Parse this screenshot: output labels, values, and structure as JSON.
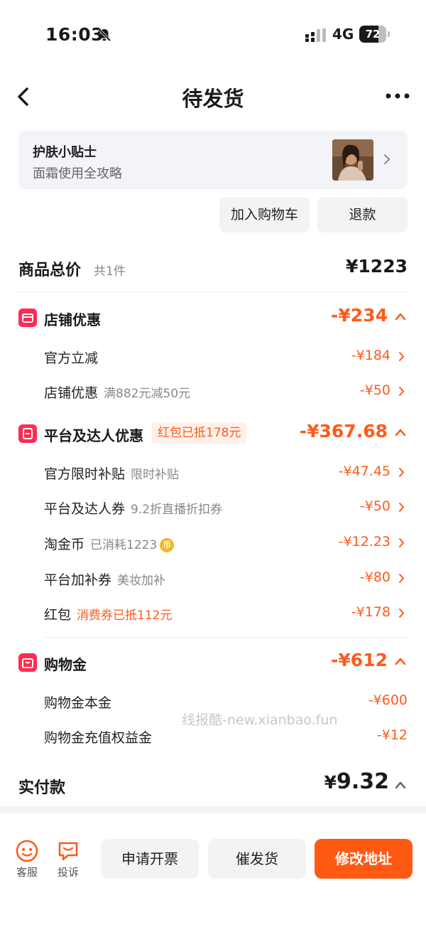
{
  "status_bar": {
    "time": "16:03",
    "network": "4G",
    "battery": "72",
    "battery_level": 0.72
  },
  "nav": {
    "title": "待发货"
  },
  "tip": {
    "title": "护肤小贴士",
    "subtitle": "面霜使用全攻略"
  },
  "actions": {
    "add_to_cart": "加入购物车",
    "refund": "退款"
  },
  "total": {
    "label": "商品总价",
    "count": "共1件",
    "amount": "¥1223"
  },
  "sections": [
    {
      "title": "店铺优惠",
      "badge": "",
      "amount": "-¥234",
      "items": [
        {
          "label": "官方立减",
          "sub": "",
          "amount": "-¥184"
        },
        {
          "label": "店铺优惠",
          "sub": "满882元减50元",
          "amount": "-¥50"
        }
      ]
    },
    {
      "title": "平台及达人优惠",
      "badge": "红包已抵178元",
      "amount": "-¥367.68",
      "items": [
        {
          "label": "官方限时补贴",
          "sub": "限时补贴",
          "amount": "-¥47.45"
        },
        {
          "label": "平台及达人券",
          "sub": "9.2折直播折扣券",
          "amount": "-¥50"
        },
        {
          "label": "淘金币",
          "sub": "已消耗1223",
          "amount": "-¥12.23"
        },
        {
          "label": "平台加补券",
          "sub": "美妆加补",
          "amount": "-¥80"
        },
        {
          "label": "红包",
          "sub": "消费券已抵112元",
          "amount": "-¥178"
        }
      ]
    },
    {
      "title": "购物金",
      "badge": "",
      "amount": "-¥612",
      "items": [
        {
          "label": "购物金本金",
          "sub": "",
          "amount": "-¥600"
        },
        {
          "label": "购物金充值权益金",
          "sub": "",
          "amount": "-¥12"
        }
      ]
    }
  ],
  "coin_glyph": "币",
  "watermark": "线报酷-new.xianbao.fun",
  "payment": {
    "label": "实付款",
    "currency": "¥",
    "amount": "9.32"
  },
  "bottom": {
    "service": "客服",
    "complaint": "投诉",
    "invoice": "申请开票",
    "urge": "催发货",
    "change_address": "修改地址"
  },
  "colors": {
    "accent": "#ff5a1a",
    "section_icon": "#ff2a52",
    "primary_button": "#ff5a14"
  },
  "icons": [
    "bell-slash-icon",
    "signal-icon",
    "back-icon",
    "more-icon",
    "chevron-right-icon",
    "store-icon",
    "coupon-icon",
    "wallet-bag-icon",
    "gold-coin-icon",
    "smiley-service-icon",
    "chat-complaint-icon"
  ]
}
